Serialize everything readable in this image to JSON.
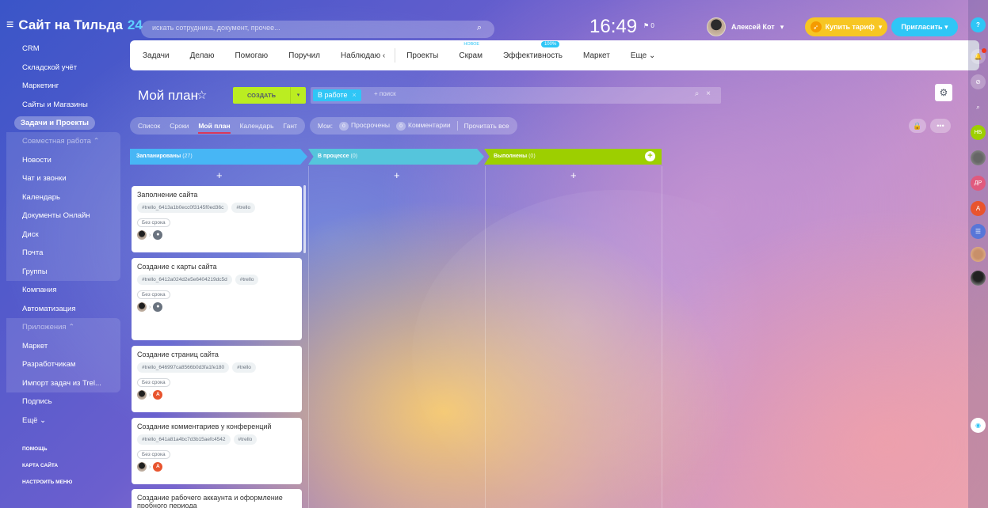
{
  "header": {
    "brand_name": "Сайт на Тильда",
    "brand_count": "24",
    "search_placeholder": "искать сотрудника, документ, прочее...",
    "clock": "16:49",
    "flag_count": "0",
    "user_name": "Алексей Кот",
    "tariff_button": "Купить тариф",
    "invite_button": "Пригласить"
  },
  "sidebar": {
    "items_top": [
      "CRM",
      "Складской учёт",
      "Маркетинг",
      "Сайты и Магазины"
    ],
    "active_item": "Задачи и Проекты",
    "group_collab_title": "Совместная работа",
    "group_collab_items": [
      "Новости",
      "Чат и звонки",
      "Календарь",
      "Документы Онлайн",
      "Диск",
      "Почта",
      "Группы"
    ],
    "items_mid": [
      "Компания",
      "Автоматизация"
    ],
    "group_apps_title": "Приложения",
    "group_apps_items": [
      "Маркет",
      "Разработчикам",
      "Импорт задач из Trel..."
    ],
    "items_bottom": [
      "Подпись",
      "Ещё"
    ],
    "footer_links": [
      "ПОМОЩЬ",
      "КАРТА САЙТА",
      "НАСТРОИТЬ МЕНЮ"
    ]
  },
  "nav": {
    "items": [
      "Задачи",
      "Делаю",
      "Помогаю",
      "Поручил",
      "Наблюдаю"
    ],
    "items_right": [
      "Проекты",
      "Скрам",
      "Эффективность",
      "Маркет",
      "Еще"
    ],
    "new_label": "НОВОЕ",
    "efficiency_badge": "100%"
  },
  "page": {
    "title": "Мой план",
    "create_button": "СОЗДАТЬ",
    "filter_chip": "В работе",
    "filter_placeholder": "+ поиск"
  },
  "tabs": {
    "view_tabs": [
      "Список",
      "Сроки",
      "Мой план",
      "Календарь",
      "Гант"
    ],
    "active_tab": "Мой план",
    "counters_label": "Мои:",
    "overdue_count": "0",
    "overdue_label": "Просрочены",
    "comments_count": "0",
    "comments_label": "Комментарии",
    "read_all": "Прочитать все"
  },
  "columns": [
    {
      "title": "Запланированы",
      "count": "(27)"
    },
    {
      "title": "В процессе",
      "count": "(0)"
    },
    {
      "title": "Выполнены",
      "count": "(0)"
    }
  ],
  "cards": [
    {
      "title": "Заполнение сайта",
      "tags": [
        "#trello_6413a1b0ecc0f3145f0ed36c",
        "#trello"
      ],
      "deadline": "Без срока",
      "responsible": "user"
    },
    {
      "title": "Создание с карты сайта",
      "tags": [
        "#trello_6412a024d2e5e6404219dc5d",
        "#trello"
      ],
      "deadline": "Без срока",
      "responsible": "user"
    },
    {
      "title": "Создание страниц сайта",
      "tags": [
        "#trello_646997ca8566b0d3fa1fe180",
        "#trello"
      ],
      "deadline": "Без срока",
      "responsible": "A"
    },
    {
      "title": "Создание комментариев у конференций",
      "tags": [
        "#trello_641a81a4bc7d3b15aefc4542",
        "#trello"
      ],
      "deadline": "Без срока",
      "responsible": "A"
    },
    {
      "title": "Создание рабочего аккаунта и оформление пробного периода",
      "tags": [],
      "deadline": "",
      "responsible": ""
    }
  ],
  "rail": {
    "avatars": [
      "НБ",
      "ДР",
      "А"
    ]
  },
  "colors": {
    "create_green": "#bbed21",
    "planned_blue": "#47b6f5",
    "progress_teal": "#55c5dc",
    "done_green": "#9dcf00",
    "tariff_yellow": "#f7c623",
    "invite_blue": "#2fc6f6"
  }
}
